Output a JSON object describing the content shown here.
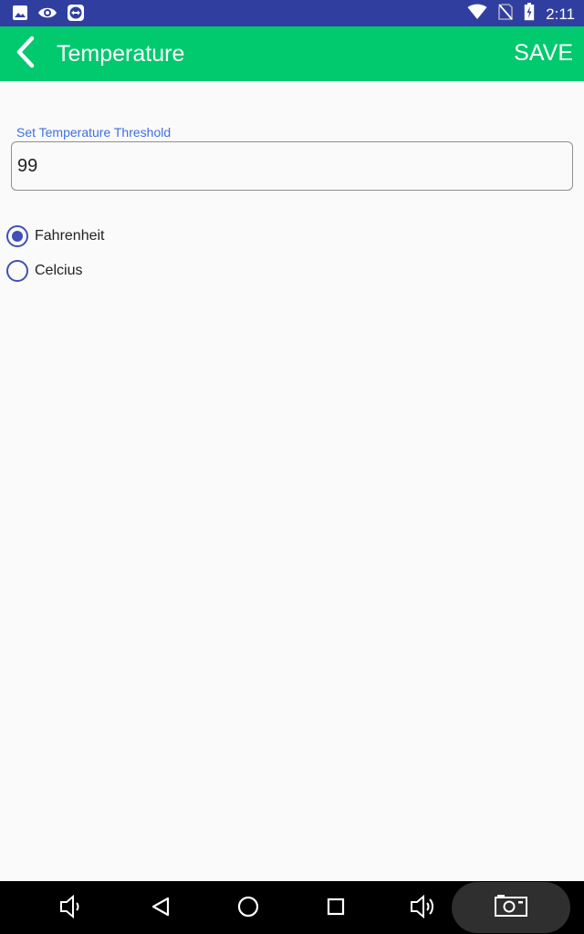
{
  "status_bar": {
    "time": "2:11",
    "left_icons": [
      "image-icon",
      "eye-icon",
      "teamviewer-icon"
    ],
    "right_icons": [
      "wifi-icon",
      "no-sim-icon",
      "battery-charging-icon"
    ]
  },
  "app_bar": {
    "title": "Temperature",
    "save_label": "SAVE",
    "back_icon": "chevron-left-icon",
    "color": "#00c96e"
  },
  "threshold": {
    "label": "Set Temperature Threshold",
    "value": "99"
  },
  "units": {
    "options": [
      "Fahrenheit",
      "Celcius"
    ],
    "selected": "Fahrenheit"
  },
  "nav_bar": {
    "icons": [
      "volume-down-icon",
      "back-triangle-icon",
      "home-circle-icon",
      "recents-square-icon",
      "volume-up-icon",
      "screenshot-camera-icon"
    ]
  },
  "colors": {
    "status_bar": "#303f9f",
    "accent": "#3f51b5",
    "label_blue": "#3f6fdf"
  }
}
